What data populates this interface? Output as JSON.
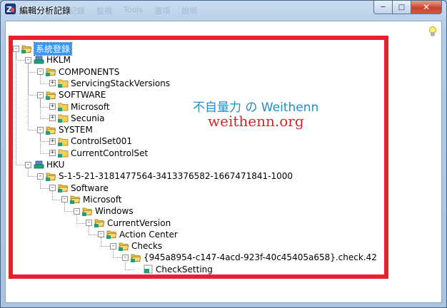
{
  "window": {
    "title": "編輯分析記錄",
    "ghost_menu": [
      "記錄",
      "監視",
      "Tools",
      "選項",
      "說明"
    ],
    "controls": {
      "minimize": "─",
      "maximize": "□",
      "close": "✕"
    }
  },
  "tree": {
    "nodes": [
      {
        "label": "系統登錄",
        "level": 0,
        "icon": "folder-open-icon",
        "expander": "-",
        "selected": true
      },
      {
        "label": "HKLM",
        "level": 1,
        "icon": "registry-hive-icon",
        "expander": "-"
      },
      {
        "label": "COMPONENTS",
        "level": 2,
        "icon": "folder-open-icon",
        "expander": "-"
      },
      {
        "label": "ServicingStackVersions",
        "level": 3,
        "icon": "folder-icon",
        "expander": "+"
      },
      {
        "label": "SOFTWARE",
        "level": 2,
        "icon": "folder-open-icon",
        "expander": "-"
      },
      {
        "label": "Microsoft",
        "level": 3,
        "icon": "folder-icon",
        "expander": "+"
      },
      {
        "label": "Secunia",
        "level": 3,
        "icon": "folder-icon",
        "expander": "+"
      },
      {
        "label": "SYSTEM",
        "level": 2,
        "icon": "folder-open-icon",
        "expander": "-"
      },
      {
        "label": "ControlSet001",
        "level": 3,
        "icon": "folder-icon",
        "expander": "+"
      },
      {
        "label": "CurrentControlSet",
        "level": 3,
        "icon": "folder-icon",
        "expander": "+"
      },
      {
        "label": "HKU",
        "level": 1,
        "icon": "registry-hive-icon",
        "expander": "-"
      },
      {
        "label": "S-1-5-21-3181477564-3413376582-1667471841-1000",
        "level": 2,
        "icon": "folder-open-icon",
        "expander": "-"
      },
      {
        "label": "Software",
        "level": 3,
        "icon": "folder-open-icon",
        "expander": "-"
      },
      {
        "label": "Microsoft",
        "level": 4,
        "icon": "folder-open-icon",
        "expander": "-"
      },
      {
        "label": "Windows",
        "level": 5,
        "icon": "folder-open-icon",
        "expander": "-"
      },
      {
        "label": "CurrentVersion",
        "level": 6,
        "icon": "folder-open-icon",
        "expander": "-"
      },
      {
        "label": "Action Center",
        "level": 7,
        "icon": "folder-open-icon",
        "expander": "-"
      },
      {
        "label": "Checks",
        "level": 8,
        "icon": "folder-open-icon",
        "expander": "-"
      },
      {
        "label": "{945a8954-c147-4acd-923f-40c45405a658}.check.42",
        "level": 9,
        "icon": "folder-open-icon",
        "expander": "-"
      },
      {
        "label": "CheckSetting",
        "level": 10,
        "icon": "registry-value-icon",
        "expander": ""
      }
    ]
  },
  "watermark": {
    "line1": "不自量力 の Weithenn",
    "line2": "weithenn.org"
  },
  "colors": {
    "highlight_frame": "#e5212a",
    "selection": "#3399ff",
    "watermark_blue": "#1e8fc8",
    "watermark_red": "#d0262a"
  }
}
